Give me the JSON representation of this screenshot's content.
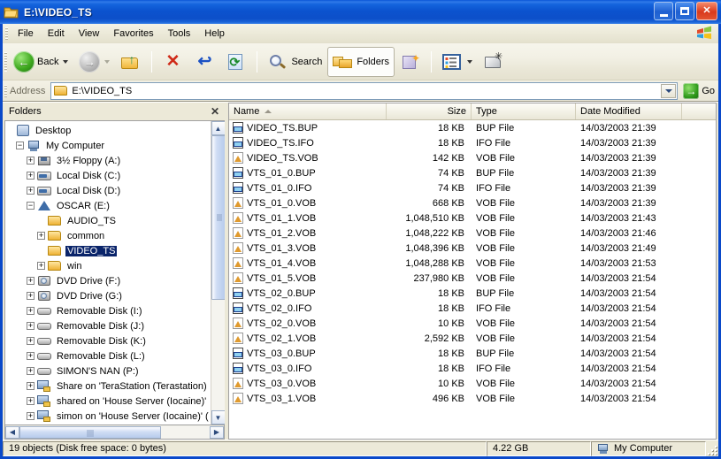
{
  "window": {
    "title": "E:\\VIDEO_TS",
    "icon": "folder-icon",
    "minimize_label": "Minimize",
    "maximize_label": "Maximize",
    "close_label": "Close"
  },
  "menubar": {
    "items": [
      {
        "label": "File"
      },
      {
        "label": "Edit"
      },
      {
        "label": "View"
      },
      {
        "label": "Favorites"
      },
      {
        "label": "Tools"
      },
      {
        "label": "Help"
      }
    ],
    "brand_icon": "windows-flag-icon"
  },
  "toolbar": {
    "back_label": "Back",
    "back_icon": "back-arrow-icon",
    "forward_icon": "forward-arrow-icon",
    "up_icon": "up-one-level-icon",
    "delete_icon": "delete-x-icon",
    "undo_icon": "undo-icon",
    "refresh_icon": "refresh-icon",
    "search_label": "Search",
    "search_icon": "search-magnifier-icon",
    "folders_label": "Folders",
    "folders_icon": "folders-icon",
    "cube_icon": "cube-icon",
    "views_icon": "views-icon",
    "photo_icon": "photo-task-icon"
  },
  "address": {
    "label": "Address",
    "value": "E:\\VIDEO_TS",
    "icon": "folder-icon",
    "dropdown_icon": "chevron-down-icon",
    "go_label": "Go",
    "go_icon": "go-arrow-icon"
  },
  "tree": {
    "header": "Folders",
    "close_icon": "close-x-icon",
    "items": [
      {
        "label": "Desktop",
        "indent": 0,
        "toggle": "",
        "icon": "desktop-icon",
        "selected": false
      },
      {
        "label": "My Computer",
        "indent": 1,
        "toggle": "−",
        "icon": "my-computer-icon",
        "selected": false
      },
      {
        "label": "3½ Floppy (A:)",
        "indent": 2,
        "toggle": "+",
        "icon": "floppy-drive-icon",
        "selected": false
      },
      {
        "label": "Local Disk (C:)",
        "indent": 2,
        "toggle": "+",
        "icon": "hard-disk-icon",
        "selected": false
      },
      {
        "label": "Local Disk (D:)",
        "indent": 2,
        "toggle": "+",
        "icon": "hard-disk-icon",
        "selected": false
      },
      {
        "label": "OSCAR (E:)",
        "indent": 2,
        "toggle": "−",
        "icon": "cd-drive-icon",
        "selected": false
      },
      {
        "label": "AUDIO_TS",
        "indent": 3,
        "toggle": "",
        "icon": "folder-icon",
        "selected": false
      },
      {
        "label": "common",
        "indent": 3,
        "toggle": "+",
        "icon": "folder-icon",
        "selected": false
      },
      {
        "label": "VIDEO_TS",
        "indent": 3,
        "toggle": "",
        "icon": "folder-icon",
        "selected": true
      },
      {
        "label": "win",
        "indent": 3,
        "toggle": "+",
        "icon": "folder-icon",
        "selected": false
      },
      {
        "label": "DVD Drive (F:)",
        "indent": 2,
        "toggle": "+",
        "icon": "dvd-drive-icon",
        "selected": false
      },
      {
        "label": "DVD Drive (G:)",
        "indent": 2,
        "toggle": "+",
        "icon": "dvd-drive-icon",
        "selected": false
      },
      {
        "label": "Removable Disk (I:)",
        "indent": 2,
        "toggle": "+",
        "icon": "removable-disk-icon",
        "selected": false
      },
      {
        "label": "Removable Disk (J:)",
        "indent": 2,
        "toggle": "+",
        "icon": "removable-disk-icon",
        "selected": false
      },
      {
        "label": "Removable Disk (K:)",
        "indent": 2,
        "toggle": "+",
        "icon": "removable-disk-icon",
        "selected": false
      },
      {
        "label": "Removable Disk (L:)",
        "indent": 2,
        "toggle": "+",
        "icon": "removable-disk-icon",
        "selected": false
      },
      {
        "label": "SIMON'S NAN (P:)",
        "indent": 2,
        "toggle": "+",
        "icon": "removable-disk-icon",
        "selected": false
      },
      {
        "label": "Share on 'TeraStation (Terastation)",
        "indent": 2,
        "toggle": "+",
        "icon": "network-drive-icon",
        "selected": false
      },
      {
        "label": "shared on 'House Server (Iocaine)'",
        "indent": 2,
        "toggle": "+",
        "icon": "network-drive-icon",
        "selected": false
      },
      {
        "label": "simon on 'House Server (Iocaine)' (",
        "indent": 2,
        "toggle": "+",
        "icon": "network-drive-icon",
        "selected": false
      }
    ],
    "scroll_up_icon": "scroll-up-icon",
    "scroll_down_icon": "scroll-down-icon",
    "scroll_left_icon": "scroll-left-icon",
    "scroll_right_icon": "scroll-right-icon"
  },
  "filelist": {
    "columns": [
      {
        "label": "Name",
        "align": "left",
        "sorted": true
      },
      {
        "label": "Size",
        "align": "right",
        "sorted": false
      },
      {
        "label": "Type",
        "align": "left",
        "sorted": false
      },
      {
        "label": "Date Modified",
        "align": "left",
        "sorted": false
      }
    ],
    "sort_icon": "sort-ascending-icon",
    "rows": [
      {
        "name": "VIDEO_TS.BUP",
        "size": "18 KB",
        "type": "BUP File",
        "date": "14/03/2003 21:39",
        "icon": "bup"
      },
      {
        "name": "VIDEO_TS.IFO",
        "size": "18 KB",
        "type": "IFO File",
        "date": "14/03/2003 21:39",
        "icon": "ifo"
      },
      {
        "name": "VIDEO_TS.VOB",
        "size": "142 KB",
        "type": "VOB File",
        "date": "14/03/2003 21:39",
        "icon": "vob"
      },
      {
        "name": "VTS_01_0.BUP",
        "size": "74 KB",
        "type": "BUP File",
        "date": "14/03/2003 21:39",
        "icon": "bup"
      },
      {
        "name": "VTS_01_0.IFO",
        "size": "74 KB",
        "type": "IFO File",
        "date": "14/03/2003 21:39",
        "icon": "ifo"
      },
      {
        "name": "VTS_01_0.VOB",
        "size": "668 KB",
        "type": "VOB File",
        "date": "14/03/2003 21:39",
        "icon": "vob"
      },
      {
        "name": "VTS_01_1.VOB",
        "size": "1,048,510 KB",
        "type": "VOB File",
        "date": "14/03/2003 21:43",
        "icon": "vob"
      },
      {
        "name": "VTS_01_2.VOB",
        "size": "1,048,222 KB",
        "type": "VOB File",
        "date": "14/03/2003 21:46",
        "icon": "vob"
      },
      {
        "name": "VTS_01_3.VOB",
        "size": "1,048,396 KB",
        "type": "VOB File",
        "date": "14/03/2003 21:49",
        "icon": "vob"
      },
      {
        "name": "VTS_01_4.VOB",
        "size": "1,048,288 KB",
        "type": "VOB File",
        "date": "14/03/2003 21:53",
        "icon": "vob"
      },
      {
        "name": "VTS_01_5.VOB",
        "size": "237,980 KB",
        "type": "VOB File",
        "date": "14/03/2003 21:54",
        "icon": "vob"
      },
      {
        "name": "VTS_02_0.BUP",
        "size": "18 KB",
        "type": "BUP File",
        "date": "14/03/2003 21:54",
        "icon": "bup"
      },
      {
        "name": "VTS_02_0.IFO",
        "size": "18 KB",
        "type": "IFO File",
        "date": "14/03/2003 21:54",
        "icon": "ifo"
      },
      {
        "name": "VTS_02_0.VOB",
        "size": "10 KB",
        "type": "VOB File",
        "date": "14/03/2003 21:54",
        "icon": "vob"
      },
      {
        "name": "VTS_02_1.VOB",
        "size": "2,592 KB",
        "type": "VOB File",
        "date": "14/03/2003 21:54",
        "icon": "vob"
      },
      {
        "name": "VTS_03_0.BUP",
        "size": "18 KB",
        "type": "BUP File",
        "date": "14/03/2003 21:54",
        "icon": "bup"
      },
      {
        "name": "VTS_03_0.IFO",
        "size": "18 KB",
        "type": "IFO File",
        "date": "14/03/2003 21:54",
        "icon": "ifo"
      },
      {
        "name": "VTS_03_0.VOB",
        "size": "10 KB",
        "type": "VOB File",
        "date": "14/03/2003 21:54",
        "icon": "vob"
      },
      {
        "name": "VTS_03_1.VOB",
        "size": "496 KB",
        "type": "VOB File",
        "date": "14/03/2003 21:54",
        "icon": "vob"
      }
    ]
  },
  "statusbar": {
    "objects_text": "19 objects (Disk free space: 0 bytes)",
    "size_text": "4.22 GB",
    "location_text": "My Computer",
    "location_icon": "my-computer-icon"
  },
  "colors": {
    "titlebar_blue": "#0a4fc9",
    "frame_blue": "#0a49c9",
    "selection_blue": "#0a246a",
    "face": "#ece9d8",
    "close_red": "#d93a1c"
  }
}
